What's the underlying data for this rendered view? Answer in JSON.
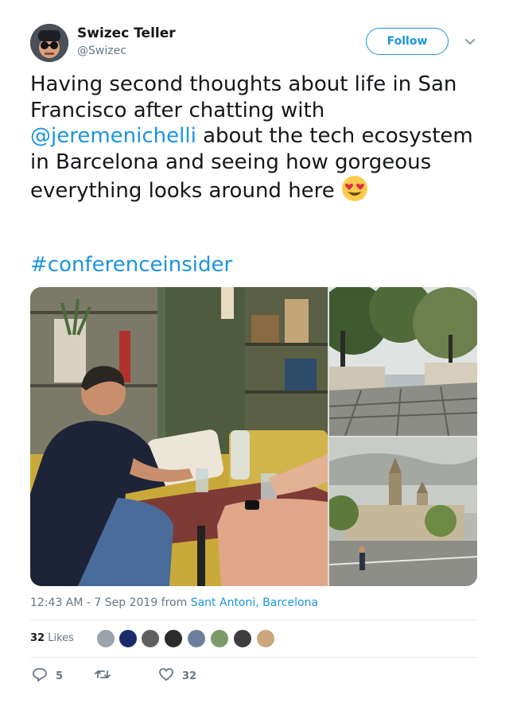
{
  "author": {
    "display_name": "Swizec Teller",
    "handle": "@Swizec"
  },
  "follow_button": {
    "label": "Follow",
    "color": "#1b95e0"
  },
  "tweet": {
    "text_before": "Having second thoughts about life in San Francisco after chatting with ",
    "mention": "@jeremenichelli",
    "text_after": " about the tech ecosystem in Barcelona and seeing how gorgeous everything looks around here ",
    "emoji": "heart-eyes-emoji",
    "hashtag": "#conferenceinsider"
  },
  "media": {
    "photos": [
      "cafe-conversation-photo",
      "barcelona-street-photo",
      "barcelona-skyline-photo"
    ]
  },
  "meta": {
    "time": "12:43 AM - 7 Sep 2019",
    "from": " from ",
    "location": "Sant Antoni, Barcelona"
  },
  "likes": {
    "count": "32",
    "label": "Likes",
    "liker_avatars": 8
  },
  "actions": {
    "replies": "5",
    "retweets": "",
    "likes": "32"
  },
  "colors": {
    "link": "#1b95e0",
    "secondary_text": "#657786",
    "divider": "#e6ecf0"
  }
}
